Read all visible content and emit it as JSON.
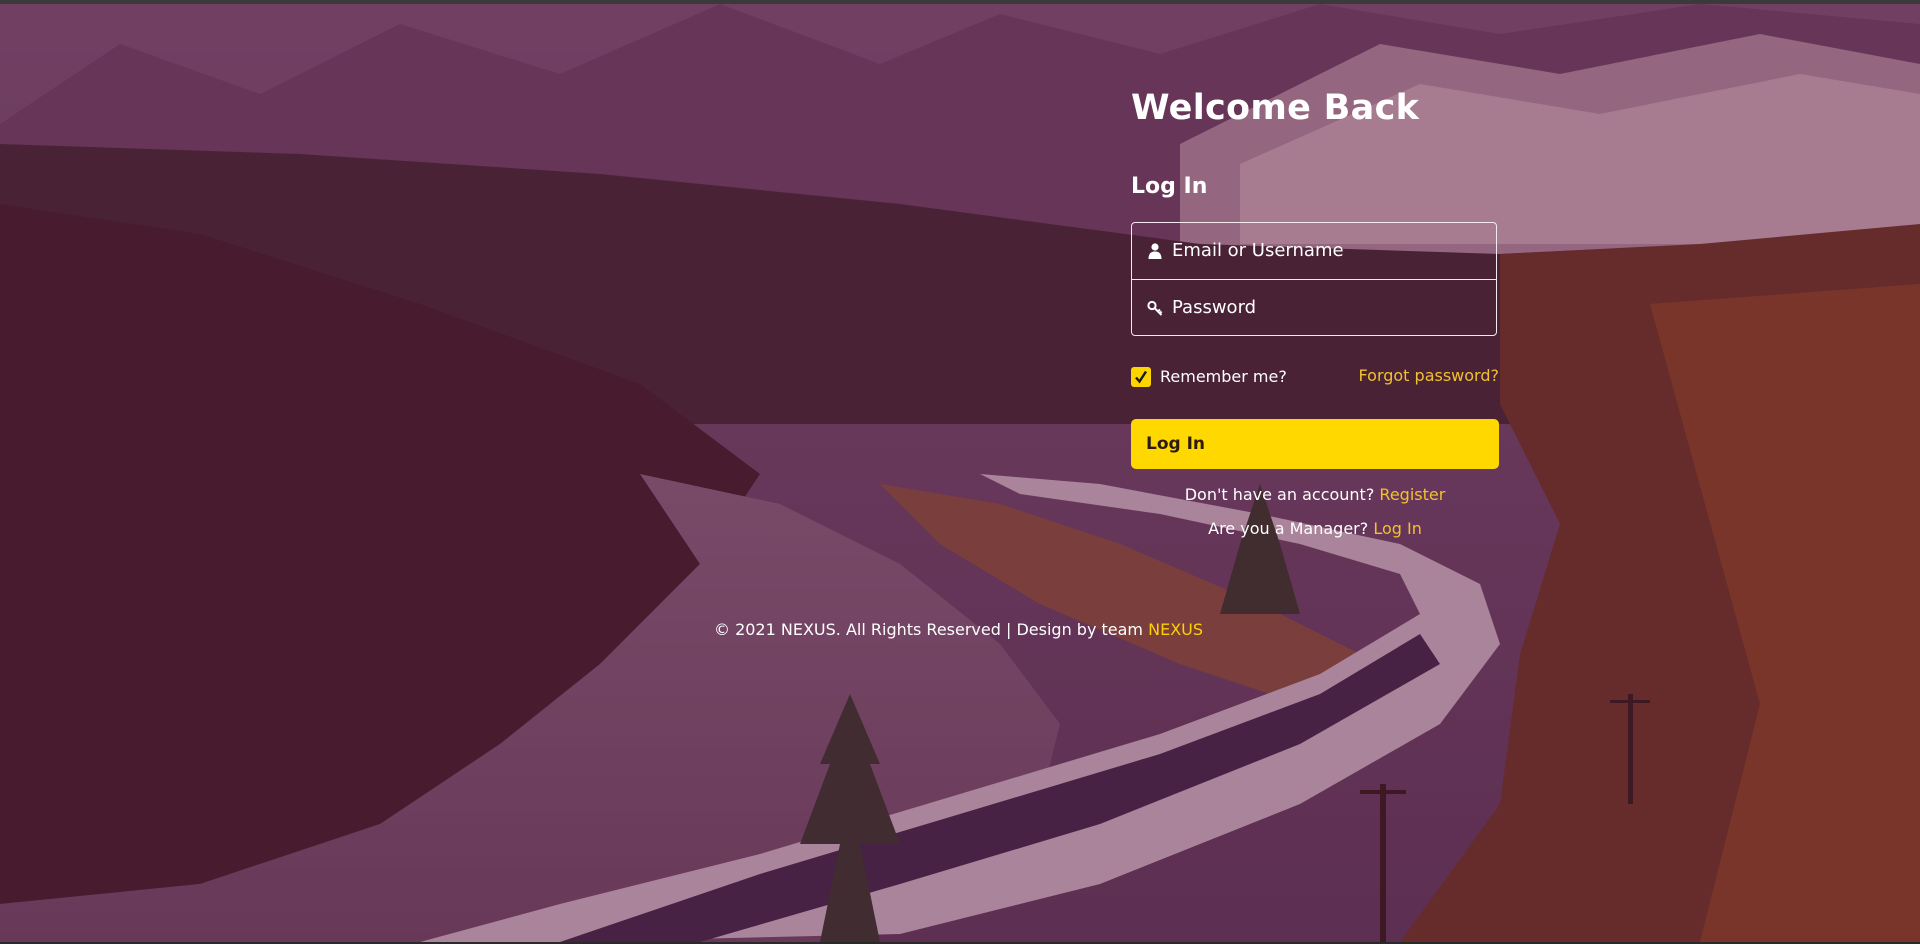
{
  "welcome": {
    "title": "Welcome Back"
  },
  "login": {
    "heading": "Log In",
    "email_placeholder": "Email or Username",
    "password_placeholder": "Password",
    "remember_label": "Remember me?",
    "remember_checked": true,
    "forgot_link": "Forgot password?",
    "submit_label": "Log In"
  },
  "register": {
    "prompt": "Don't have an account?",
    "link": "Register"
  },
  "manager": {
    "prompt": "Are you a Manager?",
    "link": "Log In"
  },
  "footer": {
    "copyright": "© 2021 NEXUS. All Rights Reserved | Design by team",
    "team_link": "NEXUS"
  },
  "icons": {
    "email": "user-icon",
    "password": "key-icon",
    "checkbox": "check-icon"
  },
  "colors": {
    "accent": "#ffd800",
    "link": "#f2c12e",
    "overlay": "#5f143c"
  }
}
